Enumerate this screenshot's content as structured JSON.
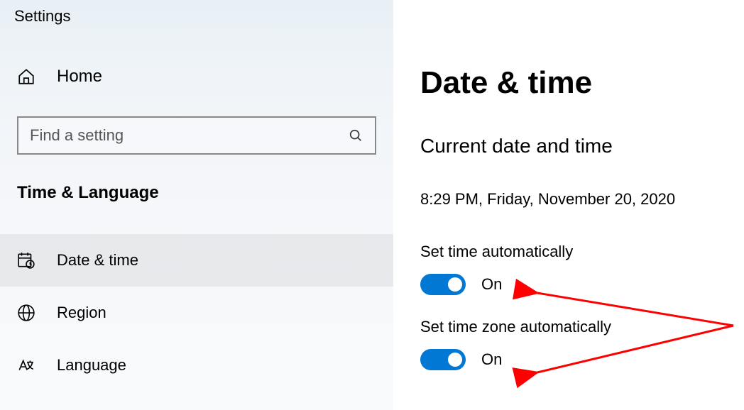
{
  "app_title": "Settings",
  "sidebar": {
    "home_label": "Home",
    "search_placeholder": "Find a setting",
    "category": "Time & Language",
    "items": [
      {
        "label": "Date & time",
        "icon": "calendar-clock-icon",
        "active": true
      },
      {
        "label": "Region",
        "icon": "globe-icon",
        "active": false
      },
      {
        "label": "Language",
        "icon": "language-icon",
        "active": false
      }
    ]
  },
  "main": {
    "title": "Date & time",
    "section_heading": "Current date and time",
    "current_datetime": "8:29 PM, Friday, November 20, 2020",
    "toggles": [
      {
        "label": "Set time automatically",
        "state_label": "On",
        "on": true
      },
      {
        "label": "Set time zone automatically",
        "state_label": "On",
        "on": true
      }
    ]
  },
  "colors": {
    "accent": "#0078D4",
    "annotation": "#FF0000"
  }
}
